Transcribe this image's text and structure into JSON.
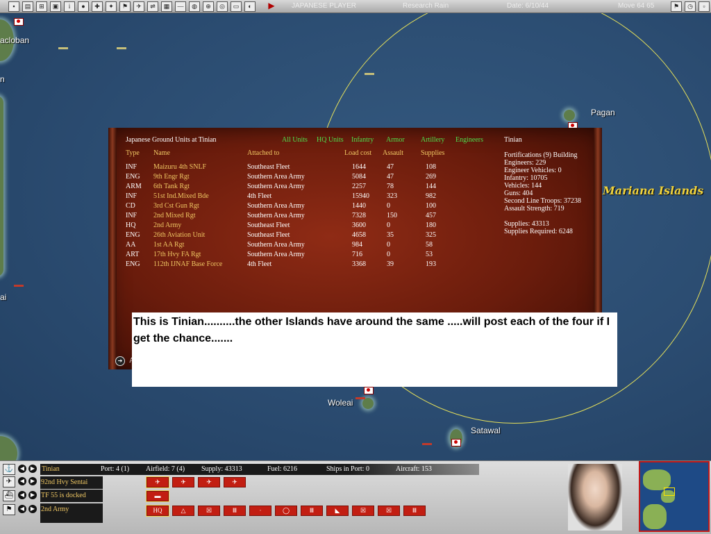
{
  "window": {
    "title": "JAPANESE PLAYER",
    "status_center": "Research Rain",
    "date": "Date: 6/10/44",
    "moves": "Move 64 65"
  },
  "map": {
    "places": {
      "tacloban": "acloban",
      "pagan": "Pagan",
      "woleai": "Woleai",
      "satawal": "Satawal",
      "edge_n": "n",
      "edge_ai": "ai"
    },
    "region": "Mariana Islands",
    "colors": {
      "range_circle": "#e6e05a",
      "sea": "#2b4c71"
    }
  },
  "panel": {
    "title": "Japanese Ground Units at Tinian",
    "filters": [
      "All Units",
      "HQ Units",
      "Infantry",
      "Armor",
      "Artillery",
      "Engineers"
    ],
    "headers": {
      "type": "Type",
      "name": "Name",
      "attached": "Attached to",
      "load": "Load cost",
      "assault": "Assault",
      "supplies": "Supplies"
    },
    "units": [
      {
        "type": "INF",
        "name": "Maizuru 4th SNLF",
        "attached": "Southeast Fleet",
        "load": "1644",
        "assault": "47",
        "supplies": "108"
      },
      {
        "type": "ENG",
        "name": "9th Engr Rgt",
        "attached": "Southern Area Army",
        "load": "5084",
        "assault": "47",
        "supplies": "269"
      },
      {
        "type": "ARM",
        "name": "6th Tank Rgt",
        "attached": "Southern Area Army",
        "load": "2257",
        "assault": "78",
        "supplies": "144"
      },
      {
        "type": "INF",
        "name": "51st Ind.Mixed Bde",
        "attached": "4th Fleet",
        "load": "15940",
        "assault": "323",
        "supplies": "982"
      },
      {
        "type": "CD",
        "name": "3rd Cst Gun Rgt",
        "attached": "Southern Area Army",
        "load": "1440",
        "assault": "0",
        "supplies": "100"
      },
      {
        "type": "INF",
        "name": "2nd Mixed Rgt",
        "attached": "Southern Area Army",
        "load": "7328",
        "assault": "150",
        "supplies": "457"
      },
      {
        "type": "HQ",
        "name": "2nd Army",
        "attached": "Southeast Fleet",
        "load": "3600",
        "assault": "0",
        "supplies": "180"
      },
      {
        "type": "ENG",
        "name": "26th Aviation Unit",
        "attached": "Southeast Fleet",
        "load": "4658",
        "assault": "35",
        "supplies": "325"
      },
      {
        "type": "AA",
        "name": "1st AA Rgt",
        "attached": "Southern Area Army",
        "load": "984",
        "assault": "0",
        "supplies": "58"
      },
      {
        "type": "ART",
        "name": "17th Hvy FA Rgt",
        "attached": "Southern Area Army",
        "load": "716",
        "assault": "0",
        "supplies": "53"
      },
      {
        "type": "ENG",
        "name": "112th IJNAF Base Force",
        "attached": "4th Fleet",
        "load": "3368",
        "assault": "39",
        "supplies": "193"
      }
    ],
    "location": "Tinian",
    "stats": [
      "Fortifications (9) Building",
      "Engineers: 229",
      "Engineer Vehicles: 0",
      "Infantry: 10705",
      "Vehicles: 144",
      "Guns: 404",
      "Second Line Troops: 37238",
      "Assault Strength: 719"
    ],
    "supplies": "Supplies: 43313",
    "supplies_required": "Supplies Required: 6248",
    "bottom_label": "A"
  },
  "note": {
    "text": "This is Tinian..........the other Islands have around the same .....will post each of the four if I get the chance......."
  },
  "bottom": {
    "location": "Tinian",
    "port": "Port: 4 (1)",
    "airfield": "Airfield: 7 (4)",
    "supply": "Supply: 43313",
    "fuel": "Fuel: 6216",
    "ships_in_port": "Ships in Port: 0",
    "aircraft": "Aircraft: 153",
    "air_unit": "92nd Hvy Sentai",
    "task_force": "TF 55 is docked",
    "ground_unit": "2nd Army",
    "hq_label": "HQ"
  }
}
